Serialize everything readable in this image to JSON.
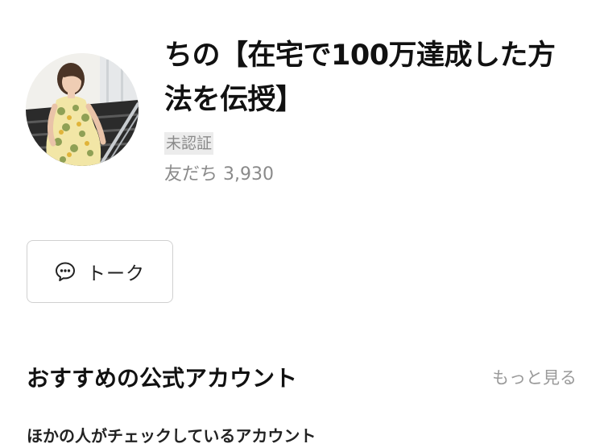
{
  "profile": {
    "account_name": "ちの【在宅で100万達成した方法を伝授】",
    "verification_badge": "未認証",
    "friends_label": "友だち",
    "friends_count": "3,930",
    "avatar": "profile-photo"
  },
  "actions": {
    "talk_label": "トーク",
    "talk_icon": "chat-bubble-icon"
  },
  "recommended": {
    "title": "おすすめの公式アカウント",
    "see_more_label": "もっと見る",
    "subtitle": "ほかの人がチェックしているアカウント"
  },
  "colors": {
    "text_primary": "#111111",
    "text_secondary": "#8a8a8a",
    "badge_bg": "#ececec",
    "button_border": "#d0d0d0"
  }
}
